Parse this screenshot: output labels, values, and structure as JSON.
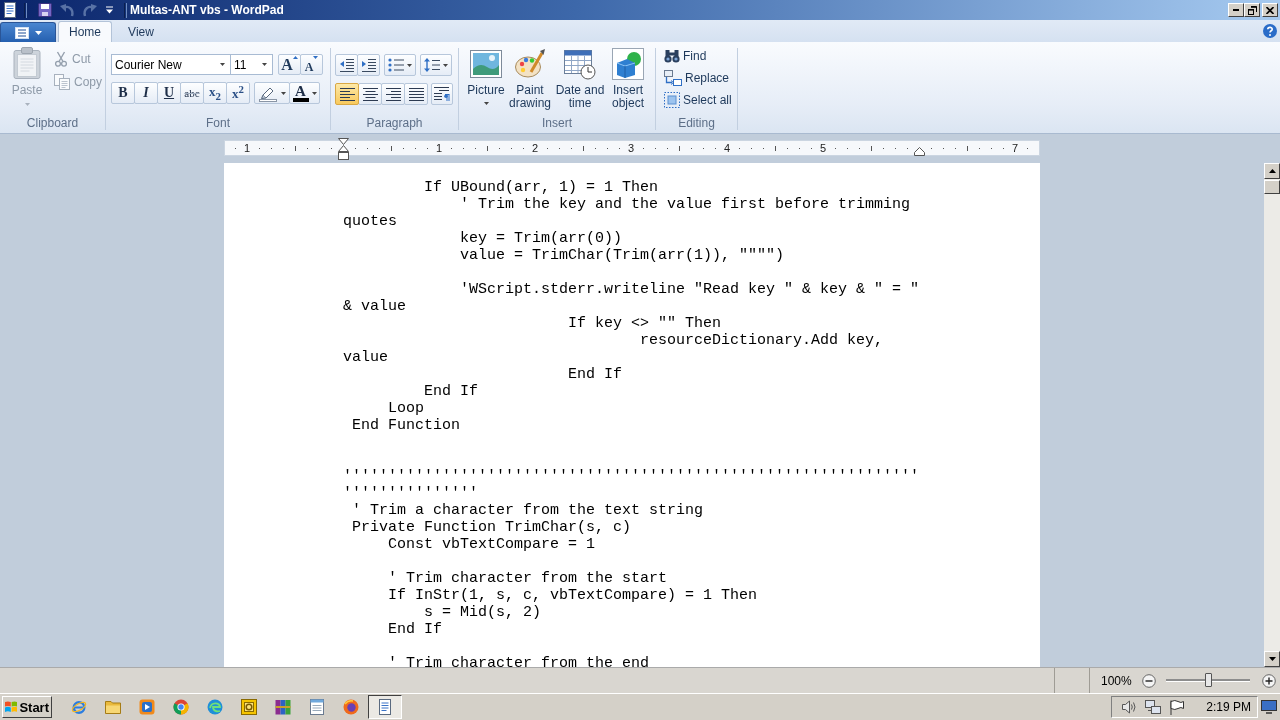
{
  "window": {
    "title": "Multas-ANT vbs - WordPad"
  },
  "quick_access": [
    {
      "kind": "save",
      "disabled": false
    },
    {
      "kind": "undo",
      "disabled": true
    },
    {
      "kind": "redo",
      "disabled": true
    },
    {
      "kind": "customize",
      "disabled": false
    }
  ],
  "tabs": [
    {
      "label": "Home",
      "selected": true
    },
    {
      "label": "View",
      "selected": false
    }
  ],
  "ribbon": {
    "clipboard": {
      "label": "Clipboard",
      "paste": {
        "label": "Paste",
        "disabled": true
      },
      "items": [
        {
          "kind": "cut",
          "label": "Cut",
          "disabled": true
        },
        {
          "kind": "copy",
          "label": "Copy",
          "disabled": true
        }
      ]
    },
    "font": {
      "label": "Font",
      "font_name": "Courier New",
      "font_size": "11",
      "size_buttons": [
        {
          "kind": "grow",
          "label": "A"
        },
        {
          "kind": "shrink",
          "label": "A"
        }
      ],
      "styles": [
        {
          "kind": "bold",
          "label": "B"
        },
        {
          "kind": "italic",
          "label": "I"
        },
        {
          "kind": "underline",
          "label": "U"
        },
        {
          "kind": "strikethrough",
          "label": "abc"
        },
        {
          "kind": "subscript",
          "label": "x$_{2}$"
        },
        {
          "kind": "superscript",
          "label": "x$^{2}$"
        }
      ],
      "text_color": {
        "label": "A"
      }
    },
    "paragraph": {
      "label": "Paragraph",
      "tools": [
        {
          "kind": "decrease-indent"
        },
        {
          "kind": "increase-indent"
        },
        {
          "kind": "bullets"
        },
        {
          "kind": "line-spacing"
        }
      ],
      "alignment": [
        {
          "kind": "left",
          "selected": true
        },
        {
          "kind": "center",
          "selected": false
        },
        {
          "kind": "right",
          "selected": false
        },
        {
          "kind": "justify",
          "selected": false
        }
      ]
    },
    "insert": {
      "label": "Insert",
      "items": [
        {
          "kind": "picture",
          "label": "Picture"
        },
        {
          "kind": "paint",
          "label": "Paint drawing"
        },
        {
          "kind": "date-time",
          "label": "Date and time"
        },
        {
          "kind": "object",
          "label": "Insert object"
        }
      ]
    },
    "editing": {
      "label": "Editing",
      "items": [
        {
          "kind": "find",
          "label": "Find"
        },
        {
          "kind": "replace",
          "label": "Replace"
        },
        {
          "kind": "select-all",
          "label": "Select all"
        }
      ]
    }
  },
  "ruler": {
    "marks": [
      "1",
      "1",
      "2",
      "3",
      "4",
      "5",
      "7"
    ]
  },
  "document": {
    "lines": [
      {
        "kind": "code",
        "text": "         If UBound(arr, 1) = 1 Then"
      },
      {
        "kind": "code",
        "text": "             ' Trim the key and the value first before trimming"
      },
      {
        "kind": "code",
        "text": "quotes"
      },
      {
        "kind": "code",
        "text": "             key = Trim(arr(0))"
      },
      {
        "kind": "code",
        "text": "             value = TrimChar(Trim(arr(1)), \"\"\"\")"
      },
      {
        "kind": "blank"
      },
      {
        "kind": "code",
        "text": "             'WScript.stderr.writeline \"Read key \" & key & \" = \""
      },
      {
        "kind": "code",
        "text": "& value"
      },
      {
        "kind": "code",
        "text": "                         If key <> \"\" Then"
      },
      {
        "kind": "code",
        "text": "                                 resourceDictionary.Add key,"
      },
      {
        "kind": "code",
        "text": "value"
      },
      {
        "kind": "code",
        "text": "                         End If"
      },
      {
        "kind": "code",
        "text": "         End If"
      },
      {
        "kind": "code",
        "text": "     Loop"
      },
      {
        "kind": "code",
        "text": " End Function"
      },
      {
        "kind": "blank"
      },
      {
        "kind": "blank"
      },
      {
        "kind": "code",
        "text": "''''''''''''''''''''''''''''''''''''''''''''''''''''''''''''''''"
      },
      {
        "kind": "code",
        "text": "'''''''''''''''"
      },
      {
        "kind": "code",
        "text": " ' Trim a character from the text string"
      },
      {
        "kind": "code",
        "text": " Private Function TrimChar(s, c)"
      },
      {
        "kind": "code",
        "text": "     Const vbTextCompare = 1"
      },
      {
        "kind": "blank"
      },
      {
        "kind": "code",
        "text": "     ' Trim character from the start"
      },
      {
        "kind": "code",
        "text": "     If InStr(1, s, c, vbTextCompare) = 1 Then"
      },
      {
        "kind": "code",
        "text": "         s = Mid(s, 2)"
      },
      {
        "kind": "code",
        "text": "     End If"
      },
      {
        "kind": "blank"
      },
      {
        "kind": "code",
        "text": "     ' Trim character from the end"
      }
    ]
  },
  "status_bar": {
    "zoom": "100%",
    "zoom_slider": {
      "level": 0.5
    }
  },
  "taskbar": {
    "start": "Start",
    "apps": [
      {
        "kind": "browser-e",
        "selected": false
      },
      {
        "kind": "folder",
        "selected": false
      },
      {
        "kind": "media-player",
        "selected": false
      },
      {
        "kind": "browser-round",
        "selected": false
      },
      {
        "kind": "browser-wave",
        "selected": false
      },
      {
        "kind": "mail-box",
        "selected": false
      },
      {
        "kind": "archive",
        "selected": false
      },
      {
        "kind": "notepad",
        "selected": false
      },
      {
        "kind": "browser-fox",
        "selected": false
      },
      {
        "kind": "wordpad",
        "selected": true
      }
    ],
    "tray": [
      {
        "kind": "speaker"
      },
      {
        "kind": "network"
      },
      {
        "kind": "flag"
      }
    ],
    "clock": "2:19 PM"
  }
}
